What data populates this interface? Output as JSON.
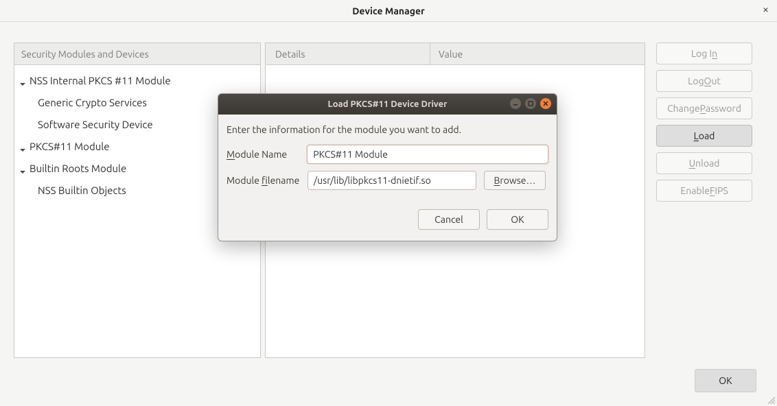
{
  "window": {
    "title": "Device Manager",
    "close_glyph": "×"
  },
  "tree": {
    "header": "Security Modules and Devices",
    "items": [
      {
        "label": "NSS Internal PKCS #11 Module",
        "expandable": true
      },
      {
        "label": "Generic Crypto Services",
        "indent": true
      },
      {
        "label": "Software Security Device",
        "indent": true
      },
      {
        "label": "PKCS#11 Module",
        "expandable": true
      },
      {
        "label": "Builtin Roots Module",
        "expandable": true
      },
      {
        "label": "NSS Builtin Objects",
        "indent": true
      }
    ]
  },
  "details": {
    "col1_header": "Details",
    "col2_header": "Value"
  },
  "side_buttons": {
    "login": {
      "pre": "Log I",
      "ul": "n",
      "post": ""
    },
    "logout": {
      "pre": "Log ",
      "ul": "O",
      "post": "ut"
    },
    "changepwd": {
      "pre": "Change ",
      "ul": "P",
      "post": "assword"
    },
    "load": {
      "pre": "",
      "ul": "L",
      "post": "oad"
    },
    "unload": {
      "pre": "",
      "ul": "U",
      "post": "nload"
    },
    "fips": {
      "pre": "Enable ",
      "ul": "F",
      "post": "IPS"
    }
  },
  "bottom": {
    "ok": "OK"
  },
  "modal": {
    "title": "Load PKCS#11 Device Driver",
    "message": "Enter the information for the module you want to add.",
    "name_label": {
      "ul": "M",
      "post": "odule Name"
    },
    "name_value": "PKCS#11 Module",
    "filename_label": {
      "pre": "Module ",
      "ul": "f",
      "post": "ilename"
    },
    "filename_value": "/usr/lib/libpkcs11-dnietif.so",
    "browse": {
      "ul": "B",
      "post": "rowse…"
    },
    "cancel": "Cancel",
    "ok": "OK"
  }
}
